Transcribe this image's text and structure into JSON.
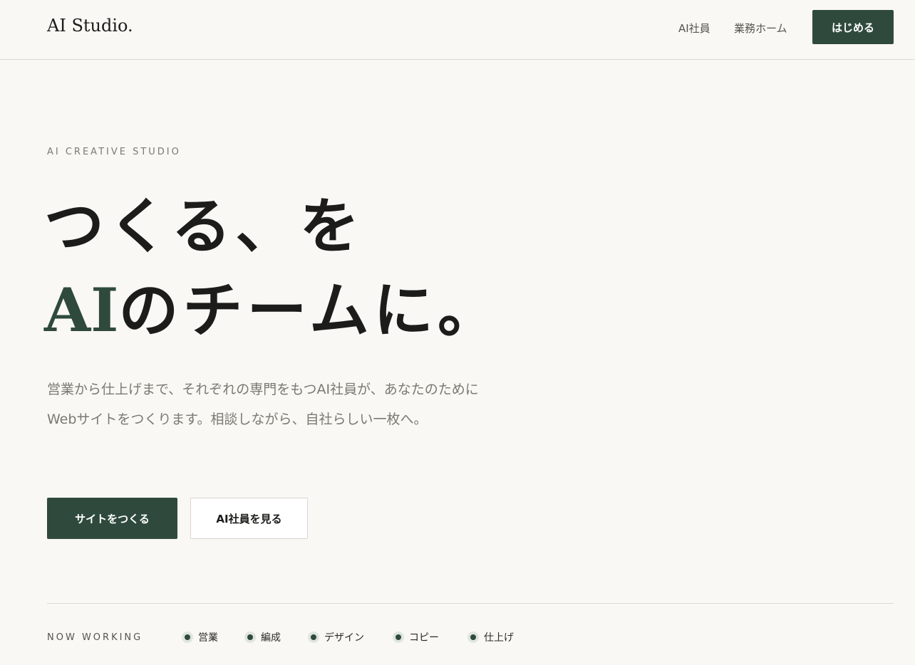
{
  "header": {
    "logo": "AI Studio.",
    "nav": [
      "AI社員",
      "業務ホーム"
    ],
    "cta": "はじめる"
  },
  "hero": {
    "eyebrow": "AI CREATIVE STUDIO",
    "headline_line1": "つくる、を",
    "headline_accent": "AI",
    "headline_line2_rest": "のチームに。",
    "lead": "営業から仕上げまで、それぞれの専門をもつAI社員が、あなたのためにWebサイトをつくります。相談しながら、自社らしい一枚へ。",
    "primary_button": "サイトをつくる",
    "secondary_button": "AI社員を見る"
  },
  "status": {
    "label": "NOW WORKING",
    "items": [
      "営業",
      "編成",
      "デザイン",
      "コピー",
      "仕上げ"
    ]
  },
  "colors": {
    "accent": "#2f4a3c",
    "background": "#f9f8f4"
  }
}
